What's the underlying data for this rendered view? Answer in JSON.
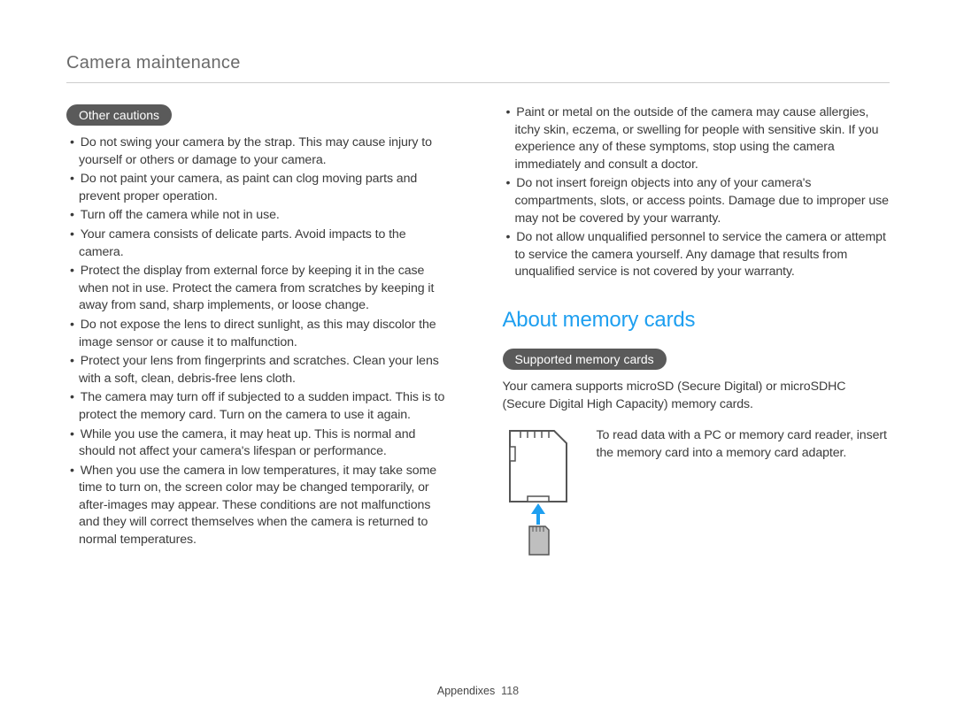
{
  "header": {
    "title": "Camera maintenance"
  },
  "left": {
    "pill": "Other cautions",
    "items": [
      "Do not swing your camera by the strap. This may cause injury to yourself or others or damage to your camera.",
      "Do not paint your camera, as paint can clog moving parts and prevent proper operation.",
      "Turn off the camera while not in use.",
      "Your camera consists of delicate parts. Avoid impacts to the camera.",
      "Protect the display from external force by keeping it in the case when not in use. Protect the camera from scratches by keeping it away from sand, sharp implements, or loose change.",
      "Do not expose the lens to direct sunlight, as this may discolor the image sensor or cause it to malfunction.",
      "Protect your lens from fingerprints and scratches. Clean your lens with a soft, clean, debris-free lens cloth.",
      " The camera may turn off if subjected to a sudden impact. This is to protect the memory card. Turn on the camera to use it again.",
      "While you use the camera, it may heat up. This is normal and should not affect your camera's lifespan or performance.",
      "When you use the camera in low temperatures, it may take some time to turn on, the screen color may be changed temporarily, or after-images may appear. These conditions are not malfunctions and they will correct themselves when the camera is returned to normal temperatures."
    ]
  },
  "right": {
    "top_items": [
      "Paint or metal on the outside of the camera may cause allergies, itchy skin, eczema, or swelling for people with sensitive skin. If you experience any of these symptoms, stop using the camera immediately and consult a doctor.",
      "Do not insert foreign objects into any of your camera's compartments, slots, or access points. Damage due to improper use may not be covered by your warranty.",
      "Do not allow unqualified personnel to service the camera or attempt to service the camera yourself. Any damage that results from unqualified service is not covered by your warranty."
    ],
    "section_heading": "About memory cards",
    "pill": "Supported memory cards",
    "support_text": "Your camera supports microSD (Secure Digital) or microSDHC (Secure Digital High Capacity) memory cards.",
    "adapter_text": "To read data with a PC or memory card reader, insert the memory card into a memory card adapter."
  },
  "footer": {
    "section": "Appendixes",
    "page": "118"
  }
}
